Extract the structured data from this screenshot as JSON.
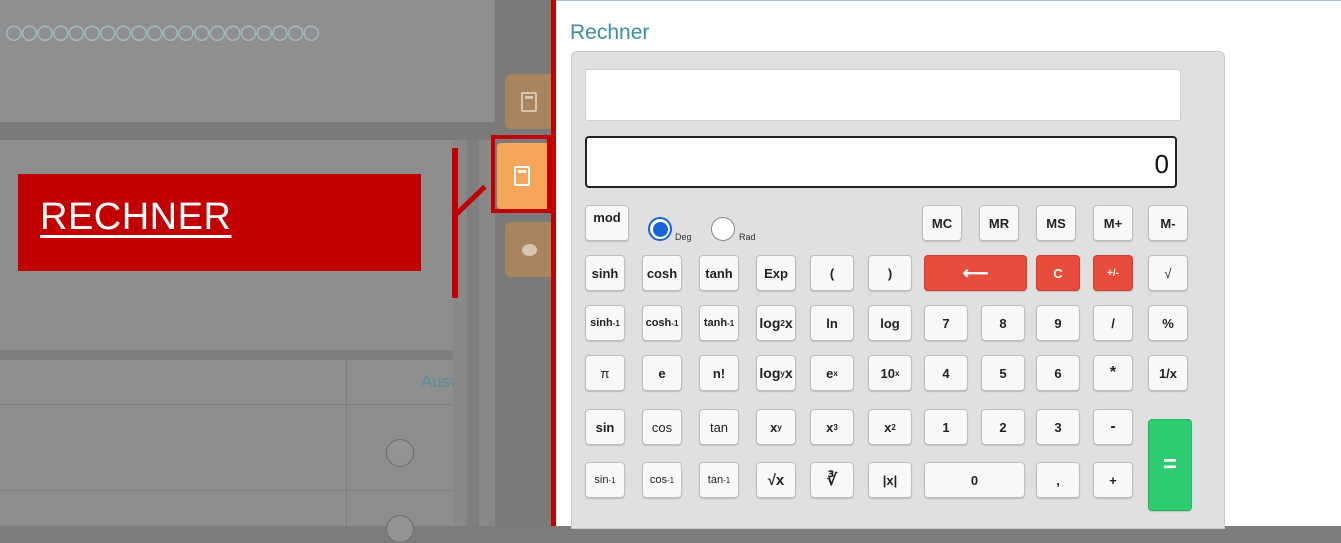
{
  "left": {
    "dots": "○○○○○○○○○○○○○○○○○○○○",
    "banner": "RECHNER",
    "table_header": "Auswahl"
  },
  "sidebar": {
    "tabs": [
      {
        "icon": "calculator-icon",
        "state": "inactive"
      },
      {
        "icon": "calculator-icon",
        "state": "active"
      },
      {
        "icon": "chat-icon",
        "state": "inactive"
      }
    ]
  },
  "calculator": {
    "title": "Rechner",
    "display_expression": "",
    "display_value": "0",
    "angle_modes": [
      {
        "label": "Deg",
        "selected": true
      },
      {
        "label": "Rad",
        "selected": false
      }
    ],
    "keys": {
      "mod": "mod",
      "mc": "MC",
      "mr": "MR",
      "ms": "MS",
      "mplus": "M+",
      "mminus": "M-",
      "sinh": "sinh",
      "cosh": "cosh",
      "tanh": "tanh",
      "exp": "Exp",
      "lparen": "(",
      "rparen": ")",
      "backspace": "⟵",
      "clear": "C",
      "sign": "+/-",
      "sqrt": "√",
      "asinh": "sinh",
      "acosh": "cosh",
      "atanh": "tanh",
      "log2": "log",
      "ln": "ln",
      "log": "log",
      "seven": "7",
      "eight": "8",
      "nine": "9",
      "divide": "/",
      "percent": "%",
      "pi": "π",
      "e": "e",
      "factorial": "n!",
      "logy": "log",
      "ex": "e",
      "tenx": "10",
      "four": "4",
      "five": "5",
      "six": "6",
      "multiply": "*",
      "reciprocal": "1/x",
      "sin": "sin",
      "cos": "cos",
      "tan": "tan",
      "xy": "x",
      "x3": "x",
      "x2": "x",
      "one": "1",
      "two": "2",
      "three": "3",
      "minus": "-",
      "equals": "=",
      "asin": "sin",
      "acos": "cos",
      "atan": "tan",
      "yroot": "√x",
      "cbrt": "∛",
      "abs": "|x|",
      "zero": "0",
      "comma": ",",
      "plus": "+"
    },
    "sup": {
      "inv": "-1",
      "x": "x",
      "y": "y",
      "three": "3",
      "two": "2"
    },
    "sub": {
      "two": "2",
      "y": "y"
    }
  },
  "colors": {
    "accent_red": "#c20000",
    "key_red": "#e74c3c",
    "key_green": "#2ecc71",
    "title_teal": "#3d8f99",
    "tab_orange": "#f5a65b"
  }
}
